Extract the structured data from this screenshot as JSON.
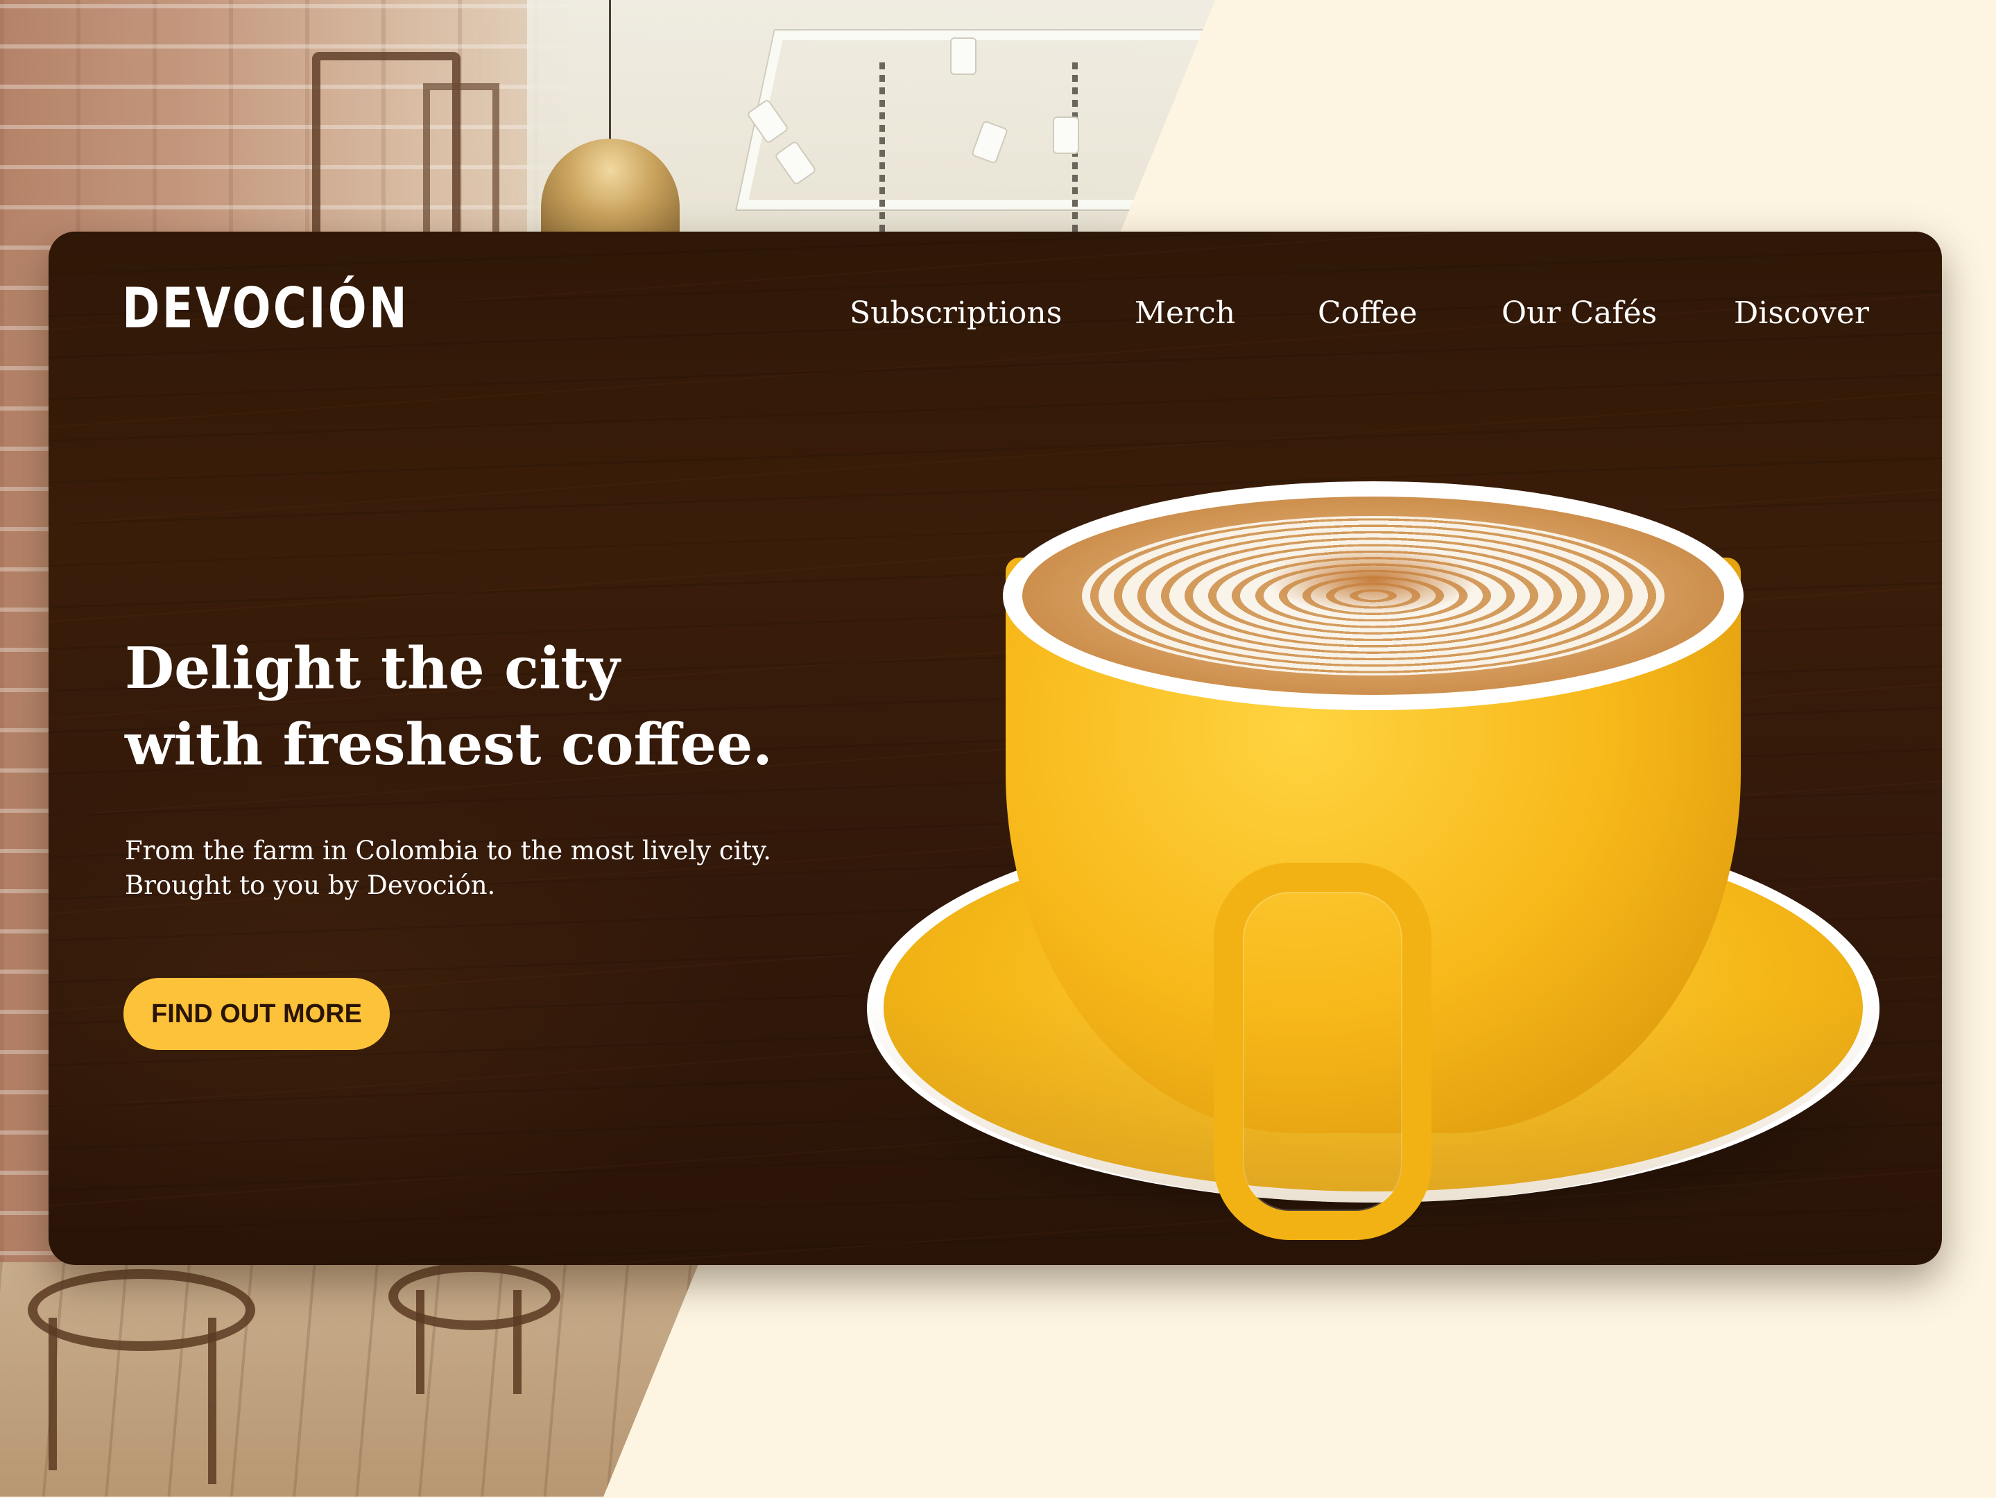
{
  "brand": {
    "logo_text": "DEVOCIÓN"
  },
  "nav": {
    "items": [
      {
        "label": "Subscriptions"
      },
      {
        "label": "Merch"
      },
      {
        "label": "Coffee"
      },
      {
        "label": "Our Cafés"
      },
      {
        "label": "Discover"
      }
    ]
  },
  "hero": {
    "headline_line1": "Delight the city",
    "headline_line2": "with freshest coffee.",
    "subtext_line1": "From the farm in Colombia to the most lively city.",
    "subtext_line2": "Brought to you by Devoción.",
    "cta_label": "FIND OUT MORE"
  },
  "colors": {
    "page_background": "#fdf5e2",
    "hero_background": "#33190a",
    "accent_yellow": "#fcc23a",
    "text_light": "#ffffff"
  }
}
